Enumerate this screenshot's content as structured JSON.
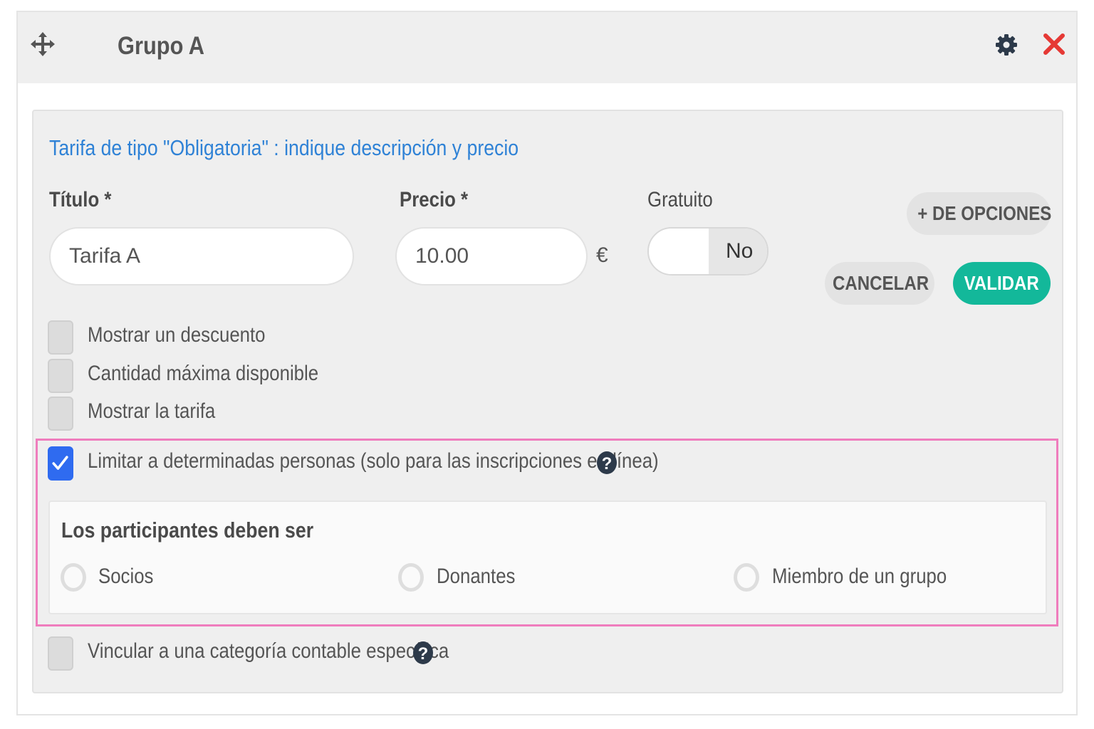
{
  "header": {
    "title": "Grupo A",
    "icons": {
      "move": "move-arrows-icon",
      "settings": "gear-icon",
      "close": "close-x-icon"
    },
    "close_color": "#e53935"
  },
  "form": {
    "intro": "Tarifa de tipo \"Obligatoria\" : indique descripción y precio",
    "title_label": "Título *",
    "title_value": "Tarifa A",
    "price_label": "Precio *",
    "price_value": "10.00",
    "currency": "€",
    "free_label": "Gratuito",
    "free_state": "No",
    "more_options": "+ DE OPCIONES",
    "cancel": "CANCELAR",
    "validate": "VALIDAR",
    "accent_color": "#13b89a",
    "link_color": "#2f82d6"
  },
  "options": {
    "discount": {
      "label": "Mostrar un descuento",
      "checked": false
    },
    "max_quantity": {
      "label": "Cantidad máxima disponible",
      "checked": false
    },
    "show_rate": {
      "label": "Mostrar la tarifa",
      "checked": false
    },
    "limit_people": {
      "label": "Limitar a determinadas personas (solo para las inscripciones en línea)",
      "checked": true
    },
    "accounting": {
      "label": "Vincular a una categoría contable específica",
      "checked": false
    }
  },
  "participants": {
    "title": "Los participantes deben ser",
    "choices": [
      "Socios",
      "Donantes",
      "Miembro de un grupo"
    ],
    "highlight_color": "#ef7dbd"
  }
}
